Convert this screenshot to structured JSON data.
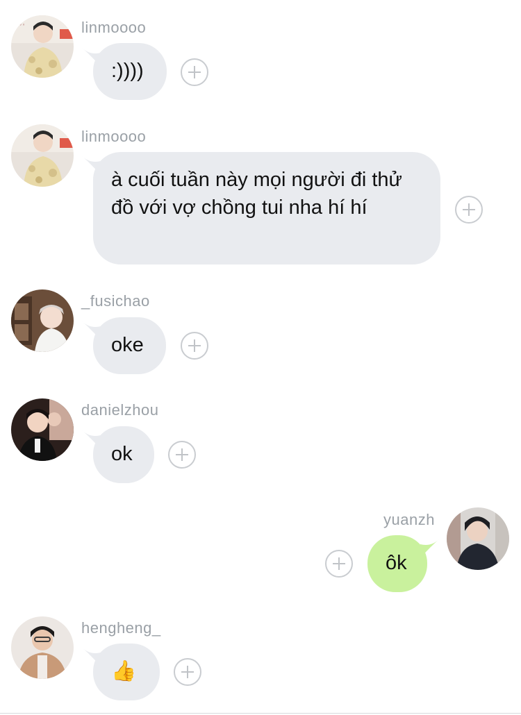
{
  "messages": [
    {
      "user": "linmoooo",
      "text": ":))))",
      "own": false,
      "avatar": "avatar-linmoooo"
    },
    {
      "user": "linmoooo",
      "text": "à cuối tuần này mọi người đi thử đồ với vợ chồng tui nha hí hí",
      "own": false,
      "avatar": "avatar-linmoooo"
    },
    {
      "user": "_fusichao",
      "text": "oke",
      "own": false,
      "avatar": "avatar-fusichao"
    },
    {
      "user": "danielzhou",
      "text": "ok",
      "own": false,
      "avatar": "avatar-danielzhou"
    },
    {
      "user": "yuanzh",
      "text": "ôk",
      "own": true,
      "avatar": "avatar-yuanzh"
    },
    {
      "user": "hengheng_",
      "text": "👍",
      "own": false,
      "avatar": "avatar-hengheng"
    }
  ],
  "colors": {
    "incoming_bubble": "#e9ebef",
    "own_bubble": "#c9f19d",
    "username": "#9aa0a6",
    "add_reaction_icon": "#c0c3c7"
  },
  "icons": {
    "add_reaction": "plus-circle-icon"
  }
}
